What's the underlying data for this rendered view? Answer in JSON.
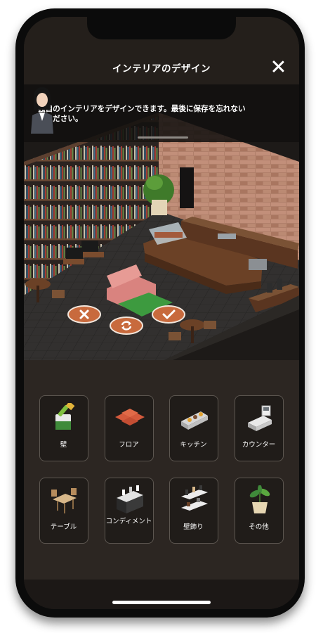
{
  "header": {
    "title": "インテリアのデザイン"
  },
  "message": {
    "text": "独自のインテリアをデザインできます。最後に保存を忘れないでください。"
  },
  "categories": [
    {
      "label": "壁",
      "icon": "paint-bucket-icon"
    },
    {
      "label": "フロア",
      "icon": "floor-tiles-icon"
    },
    {
      "label": "キッチン",
      "icon": "kitchen-icon"
    },
    {
      "label": "カウンター",
      "icon": "cash-register-icon"
    },
    {
      "label": "テーブル",
      "icon": "table-chairs-icon"
    },
    {
      "label": "コンディメント",
      "icon": "condiment-icon"
    },
    {
      "label": "壁飾り",
      "icon": "wall-shelf-icon"
    },
    {
      "label": "その他",
      "icon": "plant-icon"
    }
  ],
  "colors": {
    "accent": "#c86a3d",
    "background": "#231f1c",
    "tile_border": "#5c5650"
  }
}
